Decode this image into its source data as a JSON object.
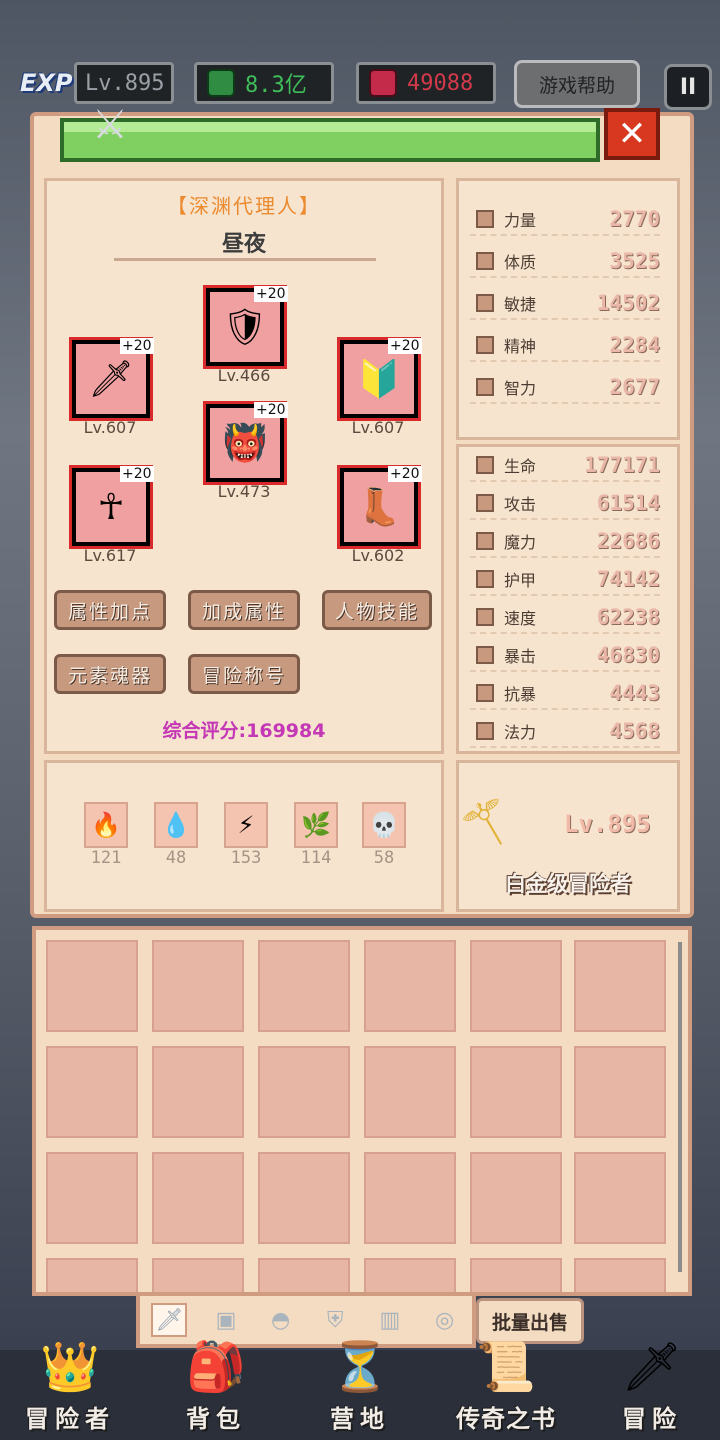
{
  "topbar": {
    "exp_label": "EXP",
    "level": "Lv.895",
    "gold": "8.3亿",
    "gems": "49088",
    "help": "游戏帮助",
    "pause": "II"
  },
  "character": {
    "title": "【深渊代理人】",
    "name": "昼夜",
    "equipment": [
      {
        "slot": "helmet",
        "plus": "+20",
        "level": "Lv.466",
        "icon": "armor-icon"
      },
      {
        "slot": "weapon",
        "plus": "+20",
        "level": "Lv.607",
        "icon": "sword-icon"
      },
      {
        "slot": "shield",
        "plus": "+20",
        "level": "Lv.607",
        "icon": "shield-icon"
      },
      {
        "slot": "armor",
        "plus": "+20",
        "level": "Lv.473",
        "icon": "chest-armor-icon"
      },
      {
        "slot": "amulet",
        "plus": "+20",
        "level": "Lv.617",
        "icon": "amulet-icon"
      },
      {
        "slot": "boots",
        "plus": "+20",
        "level": "Lv.602",
        "icon": "boots-icon"
      }
    ],
    "buttons": [
      "属性加点",
      "加成属性",
      "人物技能",
      "元素魂器",
      "冒险称号"
    ],
    "score_label": "综合评分:",
    "score_value": "169984"
  },
  "elements": [
    {
      "name": "fire",
      "value": "121"
    },
    {
      "name": "water",
      "value": "48"
    },
    {
      "name": "lightning",
      "value": "153"
    },
    {
      "name": "wind",
      "value": "114"
    },
    {
      "name": "dark",
      "value": "58"
    }
  ],
  "base_stats": [
    {
      "label": "力量",
      "value": "2770"
    },
    {
      "label": "体质",
      "value": "3525"
    },
    {
      "label": "敏捷",
      "value": "14502"
    },
    {
      "label": "精神",
      "value": "2284"
    },
    {
      "label": "智力",
      "value": "2677"
    }
  ],
  "combat_stats": [
    {
      "label": "生命",
      "value": "177171"
    },
    {
      "label": "攻击",
      "value": "61514"
    },
    {
      "label": "魔力",
      "value": "22686"
    },
    {
      "label": "护甲",
      "value": "74142"
    },
    {
      "label": "速度",
      "value": "62238"
    },
    {
      "label": "暴击",
      "value": "46830"
    },
    {
      "label": "抗暴",
      "value": "4443"
    },
    {
      "label": "法力",
      "value": "4568"
    }
  ],
  "rank": {
    "level": "Lv.895",
    "title": "白金级冒险者"
  },
  "inventory": {
    "sell_button": "批量出售"
  },
  "nav": [
    {
      "label": "冒险者"
    },
    {
      "label": "背包"
    },
    {
      "label": "营地"
    },
    {
      "label": "传奇之书"
    },
    {
      "label": "冒险"
    }
  ],
  "colors": {
    "panel_bg": "#f3dcc2",
    "panel_border": "#cf9b81",
    "title_orange": "#ec8a2f",
    "score_magenta": "#c438b6",
    "gold_green": "#3fbf5a",
    "gem_red": "#d23a4a"
  }
}
